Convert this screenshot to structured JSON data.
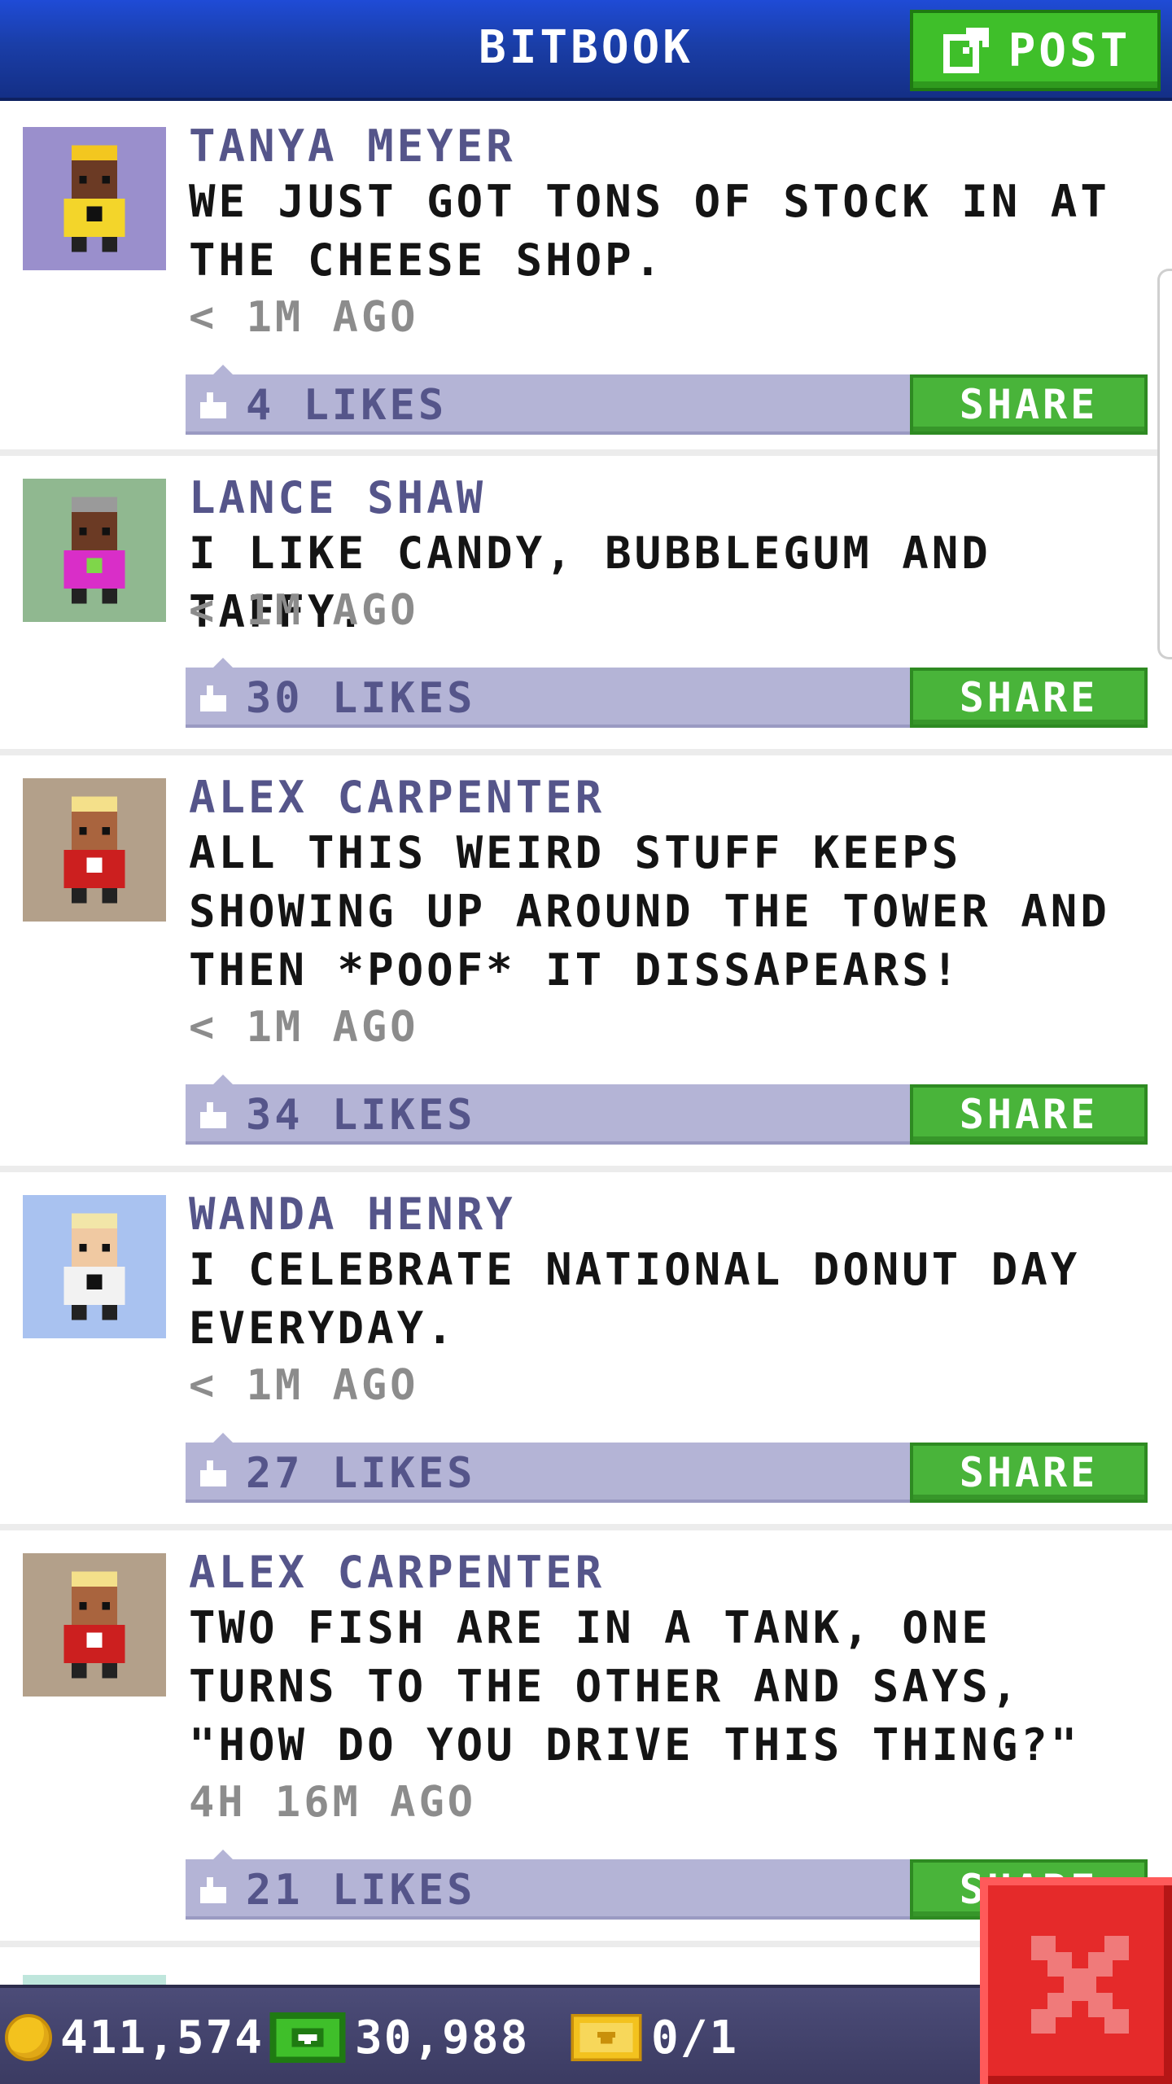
{
  "header": {
    "title": "BITBOOK",
    "post_label": "POST",
    "post_icon": "compose-icon"
  },
  "posts": [
    {
      "name": "TANYA MEYER",
      "text": "WE JUST GOT TONS OF STOCK IN AT THE CHEESE SHOP.",
      "time": "< 1M AGO",
      "likes": "4 LIKES",
      "share_label": "SHARE",
      "avatar": {
        "bg": "#9a8fcc",
        "skin": "#6b3a24",
        "hair": "#f3c71f",
        "shirt": "#f3d52a",
        "accent": "#111111"
      }
    },
    {
      "name": "LANCE SHAW",
      "text": "I LIKE CANDY, BUBBLEGUM AND TAFFY.",
      "time": "< 1M AGO",
      "likes": "30 LIKES",
      "share_label": "SHARE",
      "avatar": {
        "bg": "#90b890",
        "skin": "#6b3a24",
        "hair": "#9a9a9a",
        "shirt": "#d92ec8",
        "accent": "#7fd64a"
      }
    },
    {
      "name": "ALEX CARPENTER",
      "text": "ALL THIS WEIRD STUFF KEEPS SHOWING UP AROUND THE TOWER AND THEN *POOF* IT DISSAPEARS!",
      "time": "< 1M AGO",
      "likes": "34 LIKES",
      "share_label": "SHARE",
      "avatar": {
        "bg": "#b3a08a",
        "skin": "#a9643e",
        "hair": "#f4e08a",
        "shirt": "#cc1f1f",
        "accent": "#ffffff"
      }
    },
    {
      "name": "WANDA HENRY",
      "text": "I CELEBRATE NATIONAL DONUT DAY EVERYDAY.",
      "time": "< 1M AGO",
      "likes": "27 LIKES",
      "share_label": "SHARE",
      "avatar": {
        "bg": "#a9c2f0",
        "skin": "#f0c9a2",
        "hair": "#f2e6a8",
        "shirt": "#f2f2f2",
        "accent": "#111111"
      }
    },
    {
      "name": "ALEX CARPENTER",
      "text": "TWO FISH ARE IN A TANK, ONE TURNS TO THE OTHER AND SAYS, \"HOW DO YOU DRIVE THIS THING?\"",
      "time": "4H 16M AGO",
      "likes": "21 LIKES",
      "share_label": "SHARE",
      "avatar": {
        "bg": "#b3a08a",
        "skin": "#a9643e",
        "hair": "#f4e08a",
        "shirt": "#cc1f1f",
        "accent": "#ffffff"
      }
    }
  ],
  "footer": {
    "coins": "411,574",
    "coin_icon": "coin-icon",
    "bux": "30,988",
    "bux_icon": "cash-icon",
    "tickets": "0/1",
    "ticket_icon": "ticket-icon",
    "close_icon": "close-icon"
  },
  "colors": {
    "header": "#1a3ea8",
    "post_button": "#3fbf2a",
    "share_button": "#49b43a",
    "like_bar": "#b4b4d6",
    "name_text": "#55558a",
    "close_button": "#e52a2a"
  }
}
